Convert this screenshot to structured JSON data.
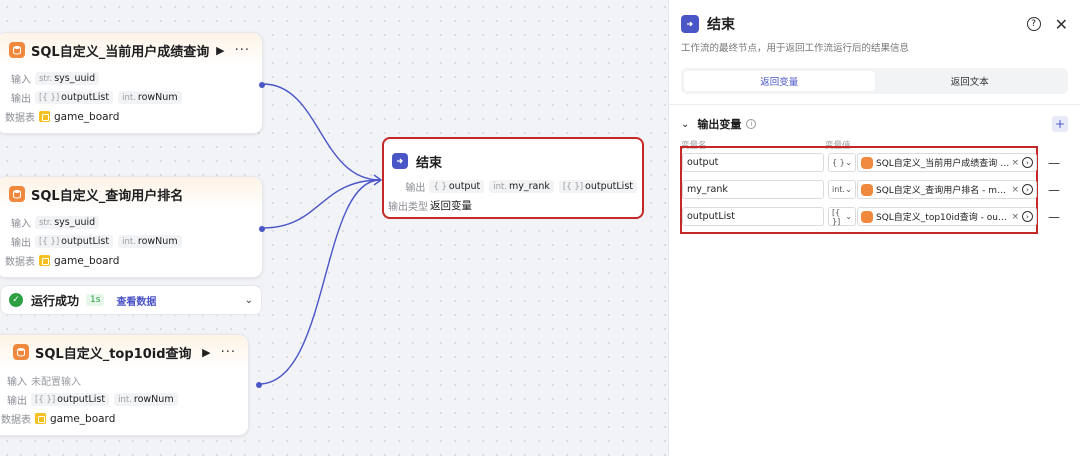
{
  "canvas": {
    "nodes": [
      {
        "title": "SQL自定义_当前用户成绩查询",
        "input_label": "输入",
        "input_tag_type": "str.",
        "input_tag_name": "sys_uuid",
        "output_label": "输出",
        "output_tags": [
          {
            "type": "[{ }]",
            "name": "outputList"
          },
          {
            "type": "int.",
            "name": "rowNum"
          }
        ],
        "table_label": "数据表",
        "table_name": "game_board"
      },
      {
        "title": "SQL自定义_查询用户排名",
        "input_label": "输入",
        "input_tag_type": "str.",
        "input_tag_name": "sys_uuid",
        "output_label": "输出",
        "output_tags": [
          {
            "type": "[{ }]",
            "name": "outputList"
          },
          {
            "type": "int.",
            "name": "rowNum"
          }
        ],
        "table_label": "数据表",
        "table_name": "game_board"
      },
      {
        "title": "SQL自定义_top10id查询",
        "input_label": "输入",
        "input_value": "未配置输入",
        "output_label": "输出",
        "output_tags": [
          {
            "type": "[{ }]",
            "name": "outputList"
          },
          {
            "type": "int.",
            "name": "rowNum"
          }
        ],
        "table_label": "数据表",
        "table_name": "game_board"
      }
    ],
    "run_status": {
      "text": "运行成功",
      "duration": "1s",
      "link": "查看数据"
    },
    "end_node": {
      "title": "结束",
      "output_label": "输出",
      "output_tags": [
        {
          "type": "{ }",
          "name": "output"
        },
        {
          "type": "int.",
          "name": "my_rank"
        },
        {
          "type": "[{ }]",
          "name": "outputList"
        }
      ],
      "type_label": "输出类型",
      "type_value": "返回变量"
    }
  },
  "panel": {
    "title": "结束",
    "description": "工作流的最终节点，用于返回工作流运行后的结果信息",
    "tabs": [
      {
        "label": "返回变量",
        "active": true
      },
      {
        "label": "返回文本",
        "active": false
      }
    ],
    "section_title": "输出变量",
    "col_name": "变量名",
    "col_value": "变量值",
    "variables": [
      {
        "name": "output",
        "type": "{ }",
        "ref": "SQL自定义_当前用户成绩查询 - o..."
      },
      {
        "name": "my_rank",
        "type": "int.",
        "ref": "SQL自定义_查询用户排名 - my_r..."
      },
      {
        "name": "outputList",
        "type": "[{ }]",
        "ref": "SQL自定义_top10id查询 - output..."
      }
    ]
  },
  "colors": {
    "accent": "#4a55c6",
    "highlight": "#c62828",
    "db_icon": "#f0883e",
    "success": "#2ea043"
  }
}
